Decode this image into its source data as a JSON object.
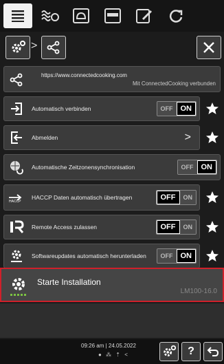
{
  "tabs": [
    {
      "icon": "list-icon",
      "active": true
    },
    {
      "icon": "cooking-icon",
      "active": false
    },
    {
      "icon": "recipe-icon",
      "active": false
    },
    {
      "icon": "oven-icon",
      "active": false
    },
    {
      "icon": "edit-icon",
      "active": false
    },
    {
      "icon": "refresh-icon",
      "active": false
    }
  ],
  "breadcrumb": {
    "separator": ">"
  },
  "connection": {
    "url": "https://www.connectedcooking.com",
    "status": "Mit ConnectedCooking verbunden"
  },
  "settings": [
    {
      "label": "Automatisch verbinden",
      "control": "toggle",
      "value": "ON",
      "off_label": "OFF",
      "on_label": "ON"
    },
    {
      "label": "Abmelden",
      "control": "arrow",
      "arrow": ">"
    },
    {
      "label": "Automatische Zeitzonensynchronisation",
      "control": "toggle",
      "value": "ON",
      "off_label": "OFF",
      "on_label": "ON"
    },
    {
      "label": "HACCP Daten automatisch übertragen",
      "control": "toggle",
      "value": "OFF",
      "off_label": "OFF",
      "on_label": "ON"
    },
    {
      "label": "Remote Access zulassen",
      "control": "toggle",
      "value": "OFF",
      "off_label": "OFF",
      "on_label": "ON"
    },
    {
      "label": "Softwareupdates automatisch herunterladen",
      "control": "toggle",
      "value": "ON",
      "off_label": "OFF",
      "on_label": "ON"
    }
  ],
  "install": {
    "title": "Starte Installation",
    "version": "LM100-16.0"
  },
  "footer": {
    "time": "09:26 am",
    "date": "24.05.2022",
    "separator": "|",
    "status_icons": "● ⁂ ⇡ <",
    "help_label": "?"
  },
  "colors": {
    "highlight": "#d0202a",
    "background": "#1c1c1c",
    "row": "#3b3b3b",
    "star": "#ffffff"
  }
}
